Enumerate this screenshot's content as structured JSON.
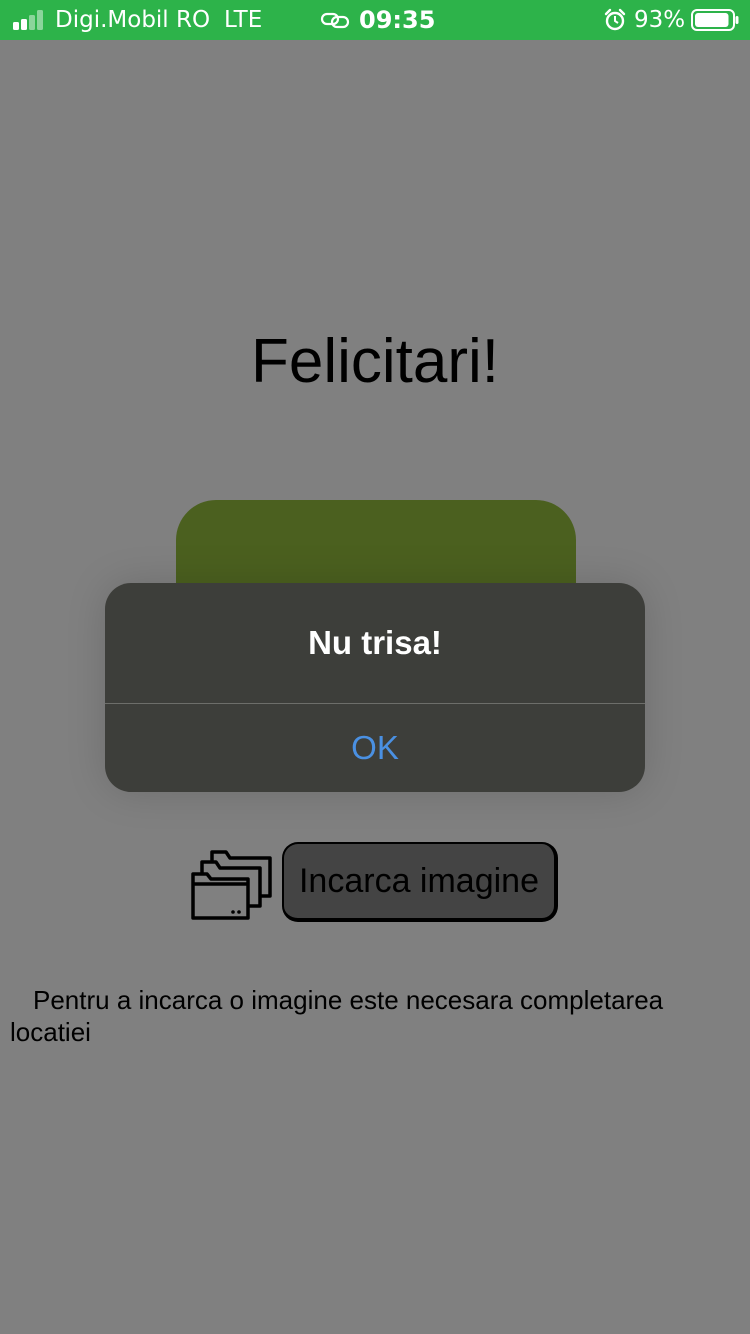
{
  "status_bar": {
    "carrier": "Digi.Mobil RO",
    "network": "LTE",
    "time": "09:35",
    "battery_percent": "93%",
    "battery_level": 0.93,
    "signal_bars_active": 2,
    "signal_bars_total": 4,
    "icons": [
      "signal-icon",
      "link-icon",
      "alarm-icon",
      "battery-icon"
    ]
  },
  "main": {
    "title": "Felicitari!",
    "upload_button_label": "Incarca imagine",
    "upload_icon": "folder-icon",
    "info_text": "Pentru a incarca o imagine este necesara completarea locatiei"
  },
  "alert": {
    "title": "Nu trisa!",
    "ok_label": "OK"
  },
  "colors": {
    "status_bar": "#2db34a",
    "background": "#808080",
    "card": "#4b601f",
    "alert_background": "#3d3e3a",
    "alert_action": "#4a90e2"
  }
}
